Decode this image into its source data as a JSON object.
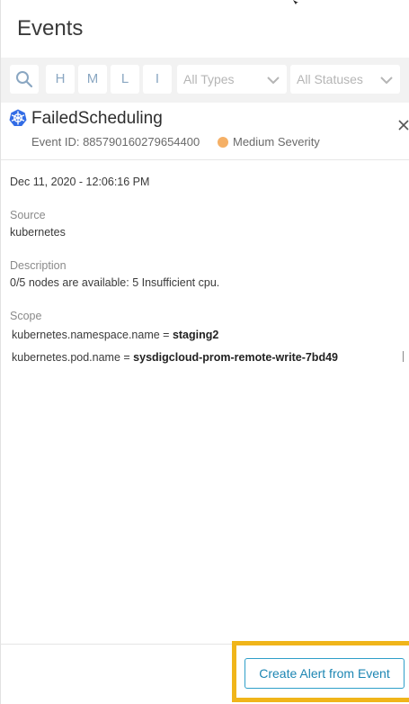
{
  "panel": {
    "title": "Events"
  },
  "filters": {
    "search_icon": "search-icon",
    "severity_buttons": [
      "H",
      "M",
      "L",
      "I"
    ],
    "types_select": {
      "value": "All Types"
    },
    "statuses_select": {
      "value": "All Statuses"
    }
  },
  "event": {
    "icon": "kubernetes-icon",
    "name": "FailedScheduling",
    "id_text": "Event ID: 885790160279654400",
    "severity": "Medium Severity",
    "severity_color": "#f5b066"
  },
  "details": {
    "timestamp": "Dec 11, 2020 - 12:06:16 PM",
    "source_label": "Source",
    "source_value": "kubernetes",
    "description_label": "Description",
    "description_value": "0/5 nodes are available: 5 Insufficient cpu.",
    "scope_label": "Scope",
    "scope": [
      {
        "key": "kubernetes.namespace.name = ",
        "value": "staging2"
      },
      {
        "key": "kubernetes.pod.name = ",
        "value": "sysdigcloud-prom-remote-write-7bd49"
      }
    ]
  },
  "footer": {
    "create_alert_label": "Create Alert from Event",
    "highlight_color": "#f0b51a",
    "accent_color": "#1d86b3"
  }
}
